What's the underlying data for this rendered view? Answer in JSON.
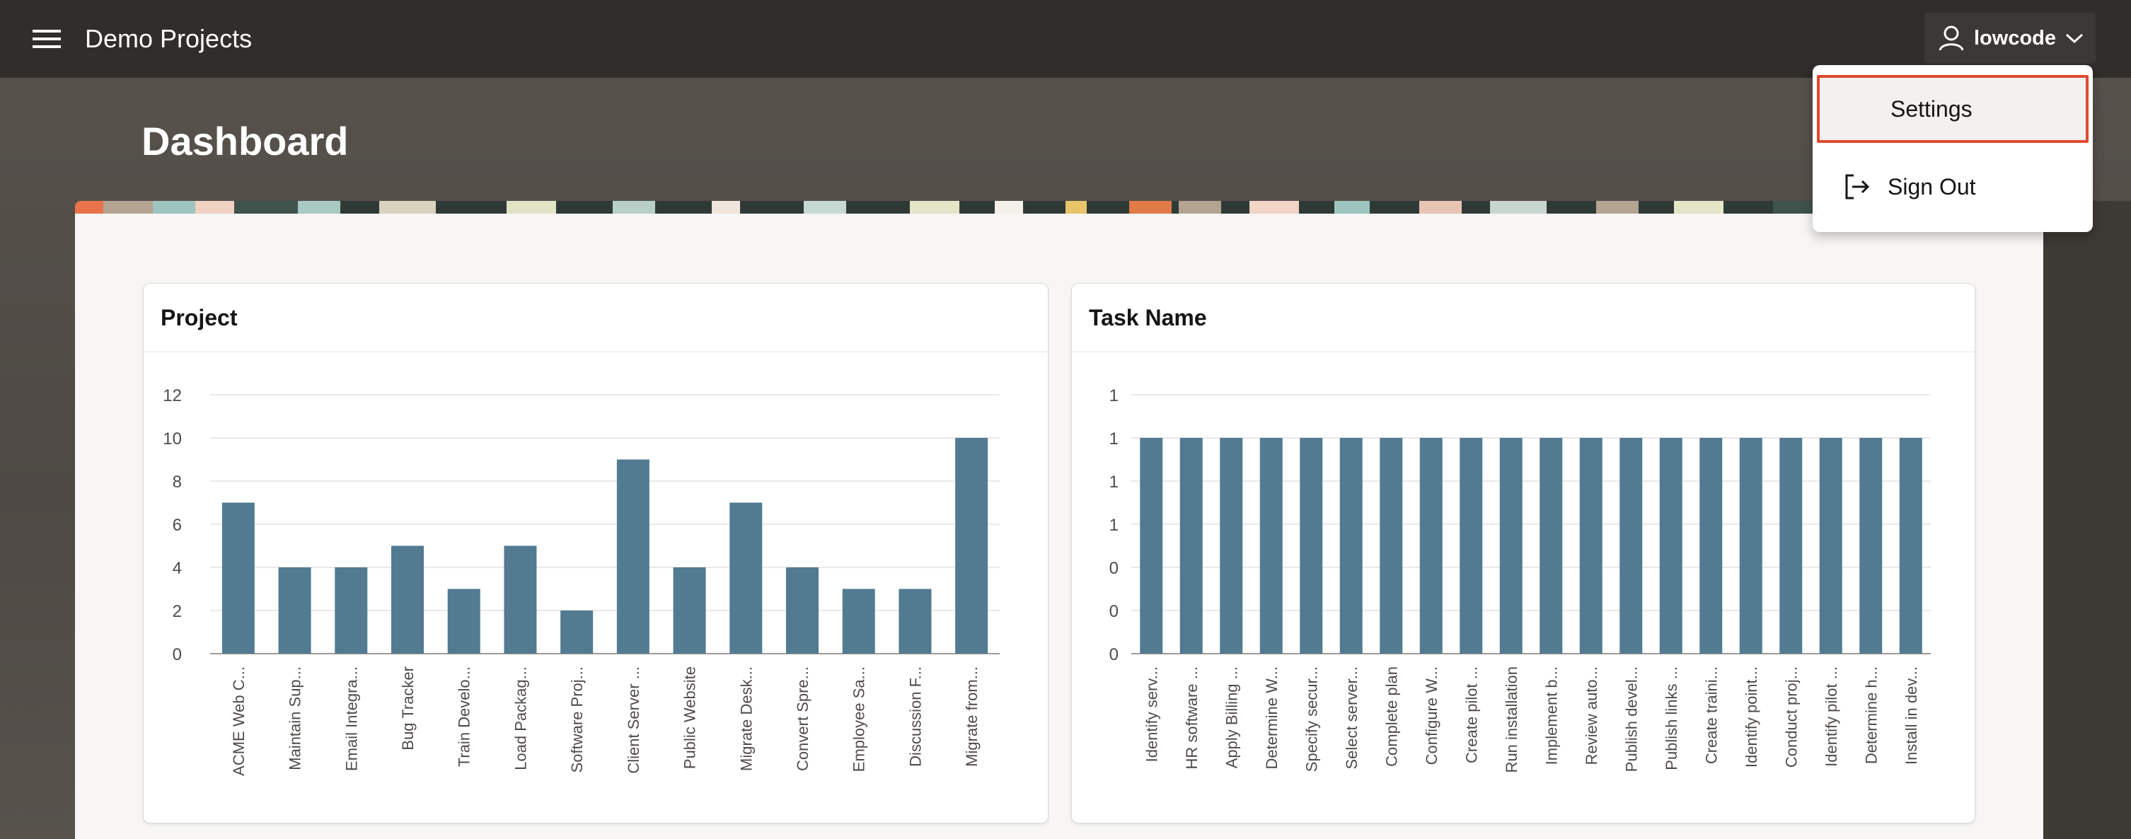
{
  "header": {
    "app_title": "Demo Projects",
    "menu_icon": "hamburger-icon",
    "user_name": "lowcode",
    "user_icon": "user-icon",
    "user_chevron": "chevron-down-icon"
  },
  "page": {
    "title": "Dashboard"
  },
  "user_menu": {
    "settings_label": "Settings",
    "signout_label": "Sign Out",
    "signout_icon": "sign-out-icon"
  },
  "colors": {
    "bar": "#527b92",
    "header": "#312d2a",
    "highlight": "#e04a2f"
  },
  "chart_data": [
    {
      "type": "bar",
      "title": "Project",
      "categories": [
        "ACME Web C...",
        "Maintain Sup...",
        "Email Integra...",
        "Bug Tracker",
        "Train Develo...",
        "Load Packag...",
        "Software Proj...",
        "Client Server ...",
        "Public Website",
        "Migrate Desk...",
        "Convert Spre...",
        "Employee Sa...",
        "Discussion F...",
        "Migrate from..."
      ],
      "values": [
        7,
        4,
        4,
        5,
        3,
        5,
        2,
        9,
        4,
        7,
        4,
        3,
        3,
        10
      ],
      "yticks": [
        "0",
        "2",
        "4",
        "6",
        "8",
        "10",
        "12"
      ],
      "ylim": [
        0,
        12
      ],
      "grid": true
    },
    {
      "type": "bar",
      "title": "Task Name",
      "categories": [
        "Identify serv...",
        "HR software ...",
        "Apply Billing ...",
        "Determine W...",
        "Specify secur...",
        "Select server...",
        "Complete plan",
        "Configure W...",
        "Create pilot ...",
        "Run installation",
        "Implement b...",
        "Review auto...",
        "Publish devel...",
        "Publish links ...",
        "Create traini...",
        "Identify point...",
        "Conduct proj...",
        "Identify pilot ...",
        "Determine h...",
        "Install in dev..."
      ],
      "values": [
        1,
        1,
        1,
        1,
        1,
        1,
        1,
        1,
        1,
        1,
        1,
        1,
        1,
        1,
        1,
        1,
        1,
        1,
        1,
        1
      ],
      "yticks": [
        "0",
        "0",
        "0",
        "1",
        "1",
        "1",
        "1"
      ],
      "ylim": [
        0,
        1.2
      ],
      "grid": true
    }
  ]
}
